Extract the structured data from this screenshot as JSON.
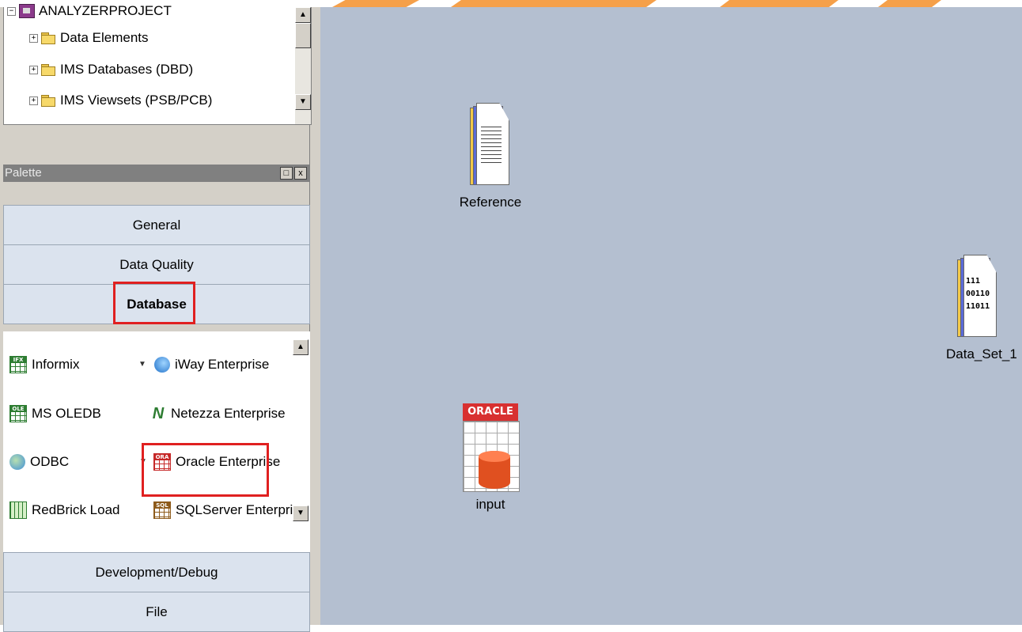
{
  "tree": {
    "root": "ANALYZERPROJECT",
    "items": [
      "Data Elements",
      "IMS Databases (DBD)",
      "IMS Viewsets (PSB/PCB)"
    ]
  },
  "palette": {
    "title": "Palette",
    "restore_btn": "□",
    "close_btn": "x",
    "groups_top": [
      "General",
      "Data Quality",
      "Database"
    ],
    "selected_group": "Database",
    "items": {
      "informix": "Informix",
      "iway": "iWay Enterprise",
      "msoledb": "MS OLEDB",
      "netezza": "Netezza Enterprise",
      "odbc": "ODBC",
      "oracle": "Oracle Enterprise",
      "redbrick": "RedBrick Load",
      "sqlserver": "SQLServer Enterprise"
    },
    "icon_labels": {
      "informix": "IFX",
      "msoledb": "OLE",
      "oracle": "ORA",
      "redbrick": "RDB",
      "sqlserver": "SQL"
    },
    "groups_bottom": [
      "Development/Debug",
      "File"
    ]
  },
  "canvas": {
    "reference": "Reference",
    "input": "input",
    "input_header": "ORACLE",
    "dataset": "Data_Set_1",
    "dataset_bits": [
      "111",
      "00110",
      "11011"
    ]
  },
  "colors": {
    "highlight": "#e02020",
    "canvas_bg": "#b4bfd0",
    "banner": "#f5a04a"
  }
}
